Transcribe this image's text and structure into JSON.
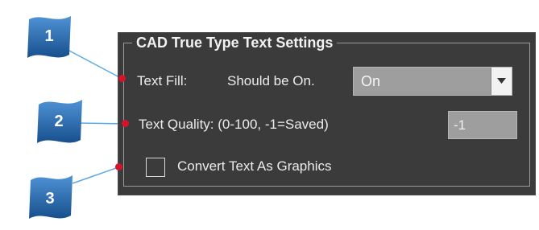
{
  "dialog": {
    "group_title": "CAD True Type Text Settings",
    "text_fill": {
      "label": "Text Fill:",
      "note": "Should  be On.",
      "selected": "On"
    },
    "text_quality": {
      "label": "Text Quality: (0-100, -1=Saved)",
      "value": "-1"
    },
    "convert_graphics": {
      "label": "Convert Text As Graphics",
      "checked": false
    }
  },
  "callouts": [
    {
      "number": "1"
    },
    {
      "number": "2"
    },
    {
      "number": "3"
    }
  ],
  "colors": {
    "panel_bg": "#3b3b3b",
    "callout_blue": "#1f63a8",
    "marker_red": "#d8122a",
    "leader_line": "#5aa9e6"
  }
}
